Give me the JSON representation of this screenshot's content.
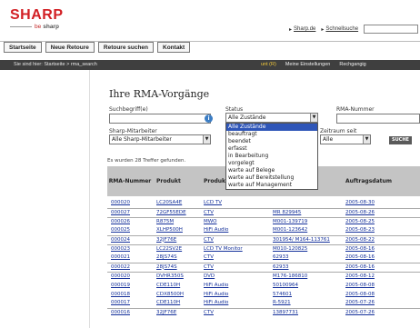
{
  "brand": {
    "logo": "SHARP",
    "tagline_prefix": "be",
    "tagline_word": "sharp"
  },
  "toplinks": {
    "links": [
      "Sharp.de",
      "Schnellsuche"
    ]
  },
  "nav": {
    "buttons": [
      "Startseite",
      "Neue Retoure",
      "Retoure suchen",
      "Kontakt"
    ]
  },
  "breadcrumb": {
    "text": "Sie sind hier: Startseite > rma_search",
    "right_accent": "unt (R)",
    "right_items": [
      "Meine Einstellungen",
      "Rechgangig"
    ]
  },
  "page_title": "Ihre RMA-Vorgänge",
  "form": {
    "search_label": "Suchbegriff(e)",
    "search_value": "",
    "status_label": "Status",
    "status_value": "Alle Zustände",
    "rma_label": "RMA-Nummer",
    "rma_value": "",
    "sharp_label": "Sharp-Mitarbeiter",
    "sharp_value": "Alle Sharp-Mitarbeiter",
    "zeitraum_label": "Zeitraum seit",
    "zeitraum_value": "Alle",
    "go_label": "SUCHE"
  },
  "status_options": [
    "Alle Zustände",
    "beauftragt",
    "beendet",
    "erfasst",
    "in Bearbeitung",
    "vorgelegt",
    "warte auf Belege",
    "warte auf Bereitstellung",
    "warte auf Management"
  ],
  "result_count": "Es wurden 28 Treffer gefunden.",
  "table": {
    "headers": [
      "RMA-Nummer",
      "Produkt",
      "Produktgruppe",
      "Referenz",
      "Auftragsdatum"
    ],
    "rows": [
      {
        "rma": "000020",
        "prod": "LC20SA4E",
        "grp": "LCD TV",
        "ref": "",
        "date": "2005-08-30"
      },
      {
        "rma": "000027",
        "prod": "72GF55EDE",
        "grp": "CTV",
        "ref": "MR 829945",
        "date": "2005-08-26"
      },
      {
        "rma": "000026",
        "prod": "R875M",
        "grp": "MWO",
        "ref": "M001-139719",
        "date": "2005-08-25"
      },
      {
        "rma": "000025",
        "prod": "XLHP500H",
        "grp": "HiFi Audio",
        "ref": "M001-123642",
        "date": "2005-08-23"
      },
      {
        "rma": "000024",
        "prod": "32JF76E",
        "grp": "CTV",
        "ref": "301954/ M164-113761",
        "date": "2005-08-22"
      },
      {
        "rma": "000023",
        "prod": "LC22SV2E",
        "grp": "LCD TV Monitor",
        "ref": "M010-120825",
        "date": "2005-08-16"
      },
      {
        "rma": "000021",
        "prod": "28JS74S",
        "grp": "CTV",
        "ref": "62933",
        "date": "2005-08-16"
      },
      {
        "rma": "000022",
        "prod": "28JS74S",
        "grp": "CTV",
        "ref": "62933",
        "date": "2005-08-16"
      },
      {
        "rma": "000020",
        "prod": "DVHR350S",
        "grp": "DVD",
        "ref": "M176-186810",
        "date": "2005-08-12"
      },
      {
        "rma": "000019",
        "prod": "CDE110H",
        "grp": "HiFi Audio",
        "ref": "50100964",
        "date": "2005-08-08"
      },
      {
        "rma": "000018",
        "prod": "CDX8500H",
        "grp": "HiFi Audio",
        "ref": "574601",
        "date": "2005-08-08"
      },
      {
        "rma": "000017",
        "prod": "CDE110H",
        "grp": "HiFi Audio",
        "ref": "R-5921",
        "date": "2005-07-26"
      },
      {
        "rma": "000016",
        "prod": "32JF76E",
        "grp": "CTV",
        "ref": "13897731",
        "date": "2005-07-26"
      }
    ]
  }
}
